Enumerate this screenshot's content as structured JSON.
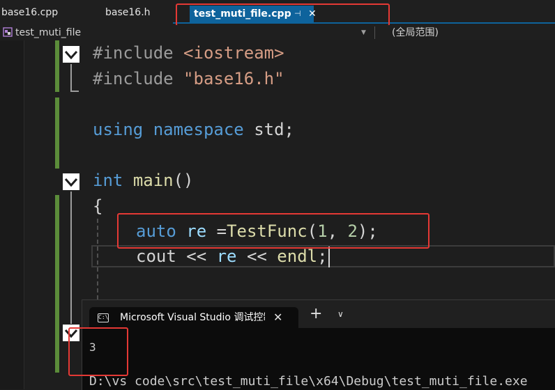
{
  "tabs": [
    {
      "label": "base16.cpp",
      "active": false
    },
    {
      "label": "base16.h",
      "active": false
    },
    {
      "label": "test_muti_file.cpp",
      "active": true,
      "pin_icon": "pin-icon",
      "close_icon": "close-icon"
    }
  ],
  "navbar": {
    "scope_label": "test_muti_file",
    "dropdown_icon": "chevron-down-icon",
    "global_scope_label": "(全局范围)"
  },
  "code": {
    "include1_directive": "#include ",
    "include1_target": "<iostream>",
    "include2_directive": "#include ",
    "include2_target": "\"base16.h\"",
    "using_kw": "using",
    "namespace_kw": "namespace",
    "using_rest": " std;",
    "int_kw": "int",
    "main_fn": "main",
    "main_parens": "()",
    "open_brace": "{",
    "auto_kw": "auto",
    "re_var": "re",
    "assign_op": " =",
    "testfunc_fn": "TestFunc",
    "paren_open": "(",
    "arg1": "1",
    "comma": ", ",
    "arg2": "2",
    "paren_close_semi": ");",
    "cout_text": "cout << ",
    "re_var2": "re",
    "shift_op": " << ",
    "endl_fn": "endl",
    "semi": ";"
  },
  "console": {
    "title": "Microsoft Visual Studio 调试控制台",
    "icon": "console-icon",
    "output": "3",
    "path": "D:\\vs code\\src\\test_muti_file\\x64\\Debug\\test_muti_file.exe"
  },
  "colors": {
    "highlight_box": "#e53935",
    "active_tab": "#0e639c",
    "change_bar": "#5b8c3a"
  }
}
